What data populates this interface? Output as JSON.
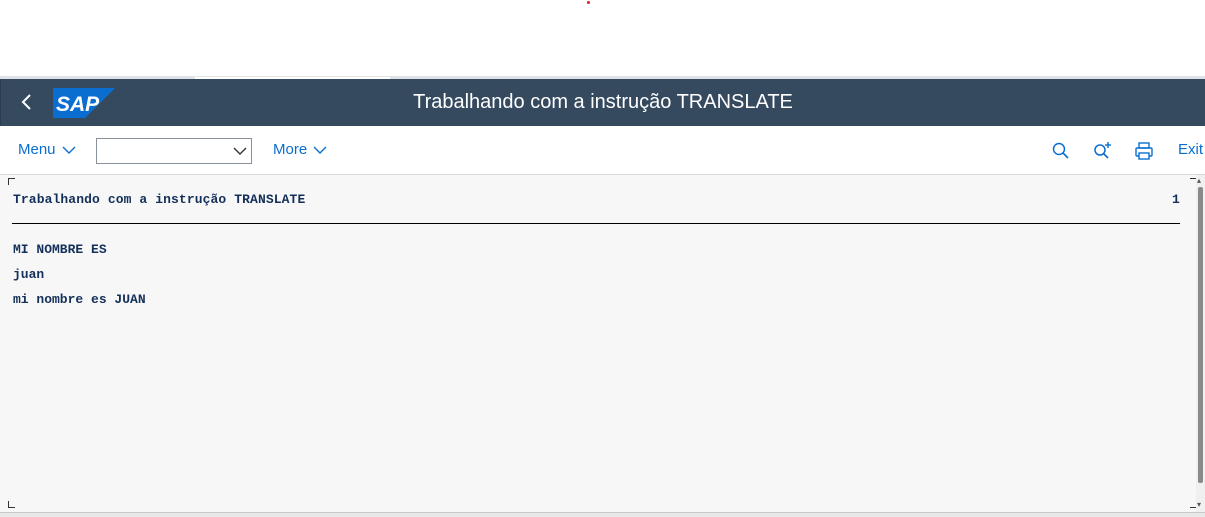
{
  "shell": {
    "title": "Trabalhando com a instrução TRANSLATE",
    "logo_text": "SAP",
    "header_color": "#354a5f",
    "logo_color": "#0a6ed1"
  },
  "toolbar": {
    "menu_label": "Menu",
    "select_value": "",
    "more_label": "More",
    "exit_label": "Exit",
    "accent_color": "#0a6ed1",
    "icons": [
      "search-icon",
      "search-next-icon",
      "print-icon"
    ]
  },
  "list": {
    "header": "Trabalhando com a instrução TRANSLATE",
    "page_number": "1",
    "lines": [
      "MI NOMBRE ES",
      "juan",
      "mi nombre es JUAN"
    ]
  }
}
